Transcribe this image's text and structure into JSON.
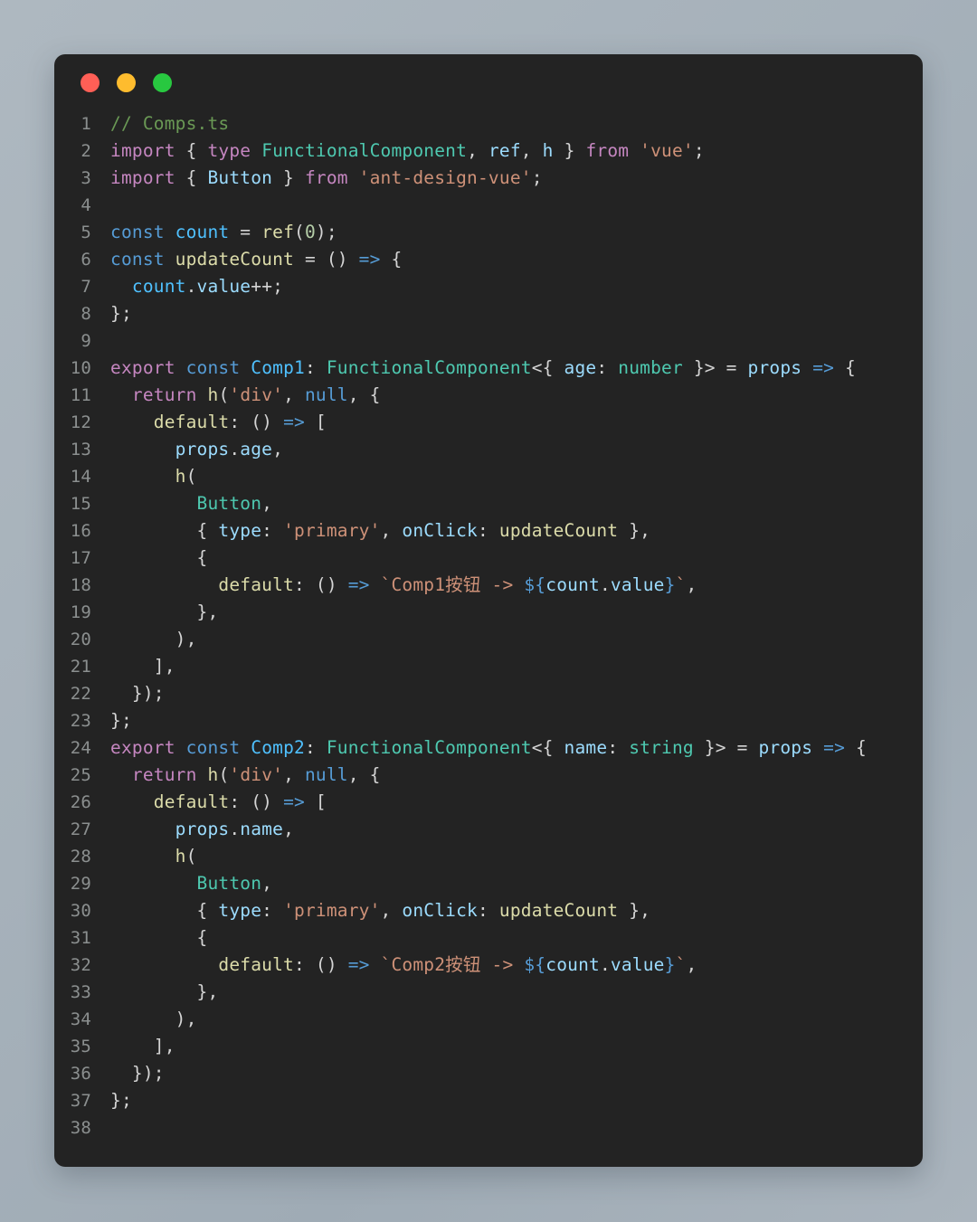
{
  "window": {
    "filename": "Comps.ts",
    "traffic_lights": [
      {
        "name": "close",
        "color": "#ff5f56"
      },
      {
        "name": "minimize",
        "color": "#febc2e"
      },
      {
        "name": "maximize",
        "color": "#28c840"
      }
    ],
    "background": "#232323",
    "page_background": "#a6b1ba"
  },
  "editor": {
    "language": "typescript",
    "total_lines": 38,
    "line_numbers": [
      1,
      2,
      3,
      4,
      5,
      6,
      7,
      8,
      9,
      10,
      11,
      12,
      13,
      14,
      15,
      16,
      17,
      18,
      19,
      20,
      21,
      22,
      23,
      24,
      25,
      26,
      27,
      28,
      29,
      30,
      31,
      32,
      33,
      34,
      35,
      36,
      37,
      38
    ],
    "code_lines": [
      "// Comps.ts",
      "import { type FunctionalComponent, ref, h } from 'vue';",
      "import { Button } from 'ant-design-vue';",
      "",
      "const count = ref(0);",
      "const updateCount = () => {",
      "  count.value++;",
      "};",
      "",
      "export const Comp1: FunctionalComponent<{ age: number }> = props => {",
      "  return h('div', null, {",
      "    default: () => [",
      "      props.age,",
      "      h(",
      "        Button,",
      "        { type: 'primary', onClick: updateCount },",
      "        {",
      "          default: () => `Comp1按钮 -> ${count.value}`,",
      "        },",
      "      ),",
      "    ],",
      "  });",
      "};",
      "export const Comp2: FunctionalComponent<{ name: string }> = props => {",
      "  return h('div', null, {",
      "    default: () => [",
      "      props.name,",
      "      h(",
      "        Button,",
      "        { type: 'primary', onClick: updateCount },",
      "        {",
      "          default: () => `Comp2按钮 -> ${count.value}`,",
      "        },",
      "      ),",
      "    ],",
      "  });",
      "};",
      ""
    ]
  },
  "theme": {
    "comment": "#6a9955",
    "keyword": "#c586c0",
    "storage": "#569cd6",
    "variable": "#9cdcfe",
    "variable_bright": "#4fc1ff",
    "function": "#dcdcaa",
    "type": "#4ec9b0",
    "string": "#ce9178",
    "number": "#b5cea8",
    "plain": "#d4d4d4",
    "line_number": "#8b8f8f"
  }
}
